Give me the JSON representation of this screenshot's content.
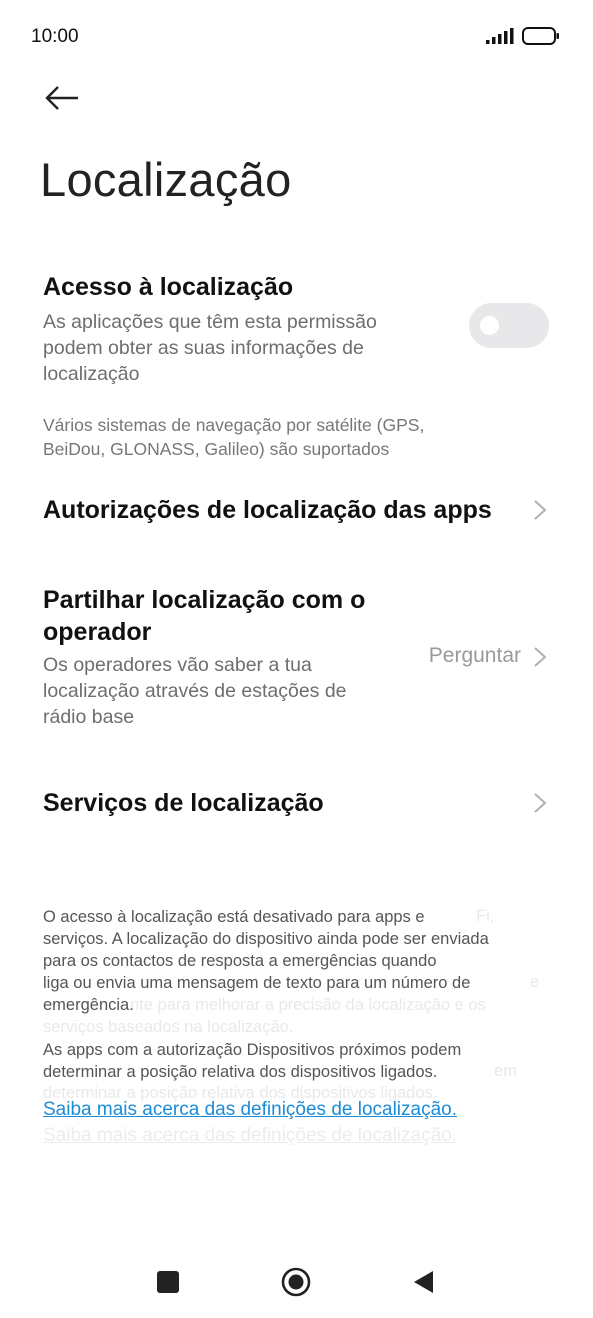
{
  "status_bar": {
    "time": "10:00",
    "signal_icon": "signal-bars-icon",
    "battery_icon": "battery-icon"
  },
  "header": {
    "back_icon": "arrow-left-icon",
    "title": "Localização"
  },
  "location_access": {
    "title": "Acesso à localização",
    "subtitle_lines": [
      "As aplicações que têm esta permissão",
      "podem obter as suas informações de",
      "localização"
    ],
    "toggle_on": false
  },
  "gnss_note_lines": [
    "Vários sistemas de navegação por satélite (GPS,",
    "BeiDou, GLONASS, Galileo) são suportados"
  ],
  "app_permissions": {
    "title": "Autorizações de localização das apps"
  },
  "share_with_operator": {
    "title_lines": [
      "Partilhar localização com o",
      "operador"
    ],
    "subtitle_lines": [
      "Os operadores vão saber a tua",
      "localização através de estações de",
      "rádio base"
    ],
    "value": "Perguntar"
  },
  "location_services": {
    "title": "Serviços de localização"
  },
  "footer": {
    "lines": [
      "O acesso à localização está desativado para apps e",
      "serviços. A localização do dispositivo ainda pode ser enviada",
      "para os contactos de resposta a emergências quando",
      "liga ou envia uma mensagem de texto para um número de",
      "emergência.",
      "As apps com a autorização Dispositivos próximos podem",
      "determinar a posição relativa dos dispositivos ligados."
    ],
    "ghost_lines": [
      "Fi,",
      "e",
      "nte para melhorar a precisão da localização e os",
      "serviços baseados na localização.",
      "em",
      "determinar a posição relativa dos dispositivos ligados."
    ],
    "learn_more": "Saiba mais acerca das definições de localização.",
    "learn_more_ghost": "Saiba mais acerca das definições de localização."
  },
  "nav_bar": {
    "recents_icon": "square-recents-icon",
    "home_icon": "circle-home-icon",
    "back_icon": "triangle-back-icon"
  },
  "colors": {
    "link": "#1a8cd8",
    "toggle_off": "#e8e8ea",
    "secondary_text": "#6e6e6e"
  }
}
